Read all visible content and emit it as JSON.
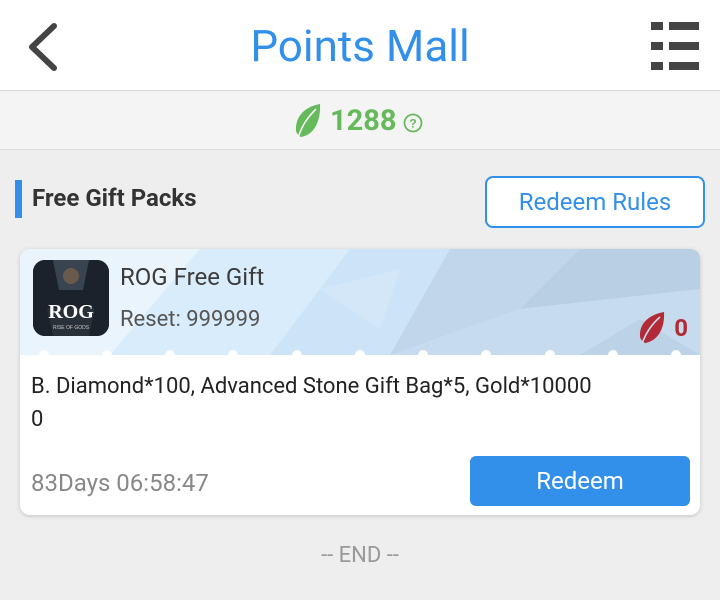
{
  "header": {
    "title": "Points Mall",
    "back_icon": "chevron-left-icon",
    "menu_icon": "list-menu-icon"
  },
  "points": {
    "value": "1288",
    "icon": "leaf-icon",
    "icon_color": "#66ba5c",
    "help_icon": "question-circle-icon"
  },
  "section": {
    "title": "Free Gift Packs",
    "rules_label": "Redeem Rules",
    "accent_color": "#3390ea"
  },
  "gift": {
    "icon_text": "ROG",
    "icon_subtext": "RISE OF GODS",
    "name": "ROG Free Gift",
    "reset": "Reset: 999999",
    "cost": "0",
    "cost_icon": "red-leaf-icon",
    "cost_color": "#b22a35",
    "description": "B. Diamond*100, Advanced Stone Gift Bag*5, Gold*100000",
    "countdown": "83Days 06:58:47",
    "redeem_label": "Redeem"
  },
  "footer": {
    "end_text": "-- END --"
  }
}
